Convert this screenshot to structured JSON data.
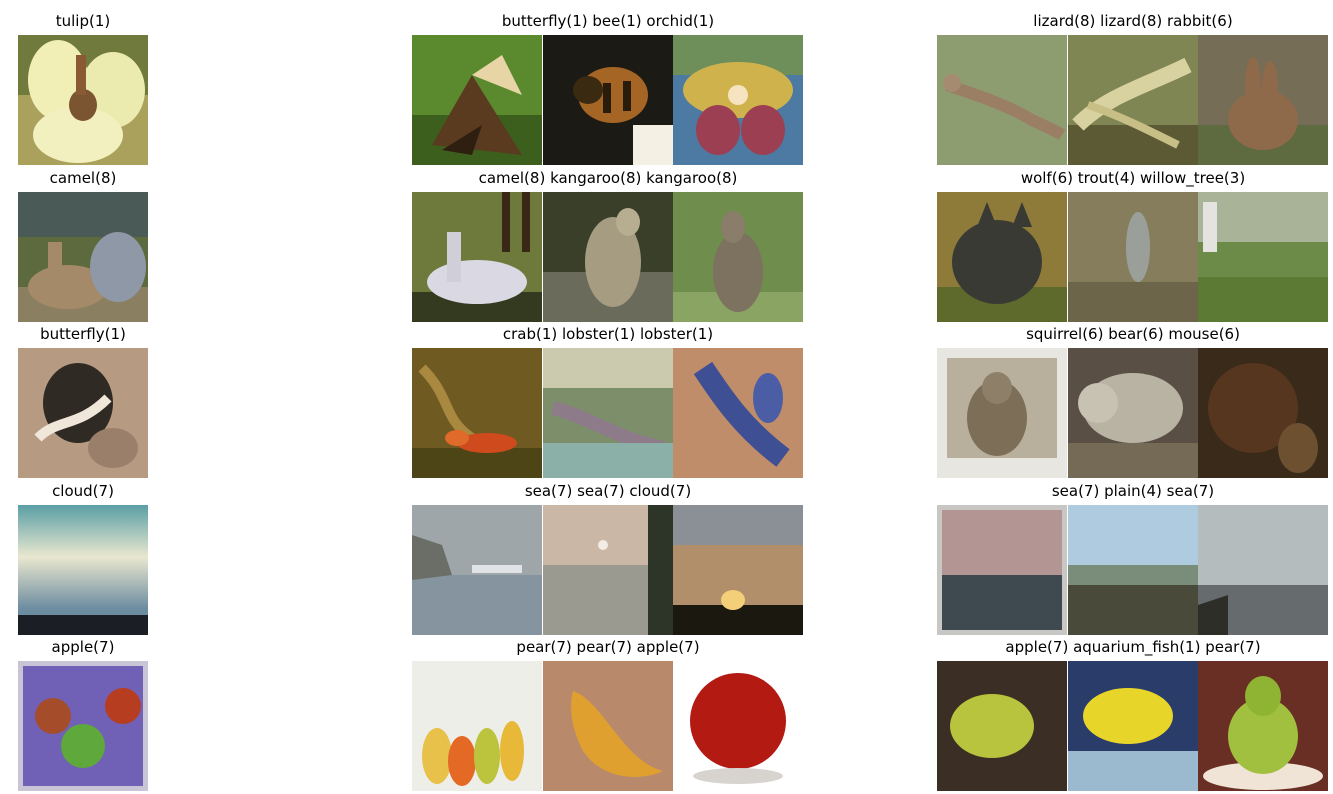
{
  "figure": {
    "rows": [
      {
        "left_title": "tulip(1)",
        "mid_title": "butterfly(1) bee(1) orchid(1)",
        "right_title": "lizard(8) lizard(8) rabbit(6)",
        "thumbs": {
          "left": [
            "tulip"
          ],
          "mid": [
            "butterfly",
            "bee",
            "orchid"
          ],
          "right": [
            "lizard",
            "lizard",
            "rabbit"
          ]
        }
      },
      {
        "left_title": "camel(8)",
        "mid_title": "camel(8) kangaroo(8) kangaroo(8)",
        "right_title": "wolf(6) trout(4) willow_tree(3)",
        "thumbs": {
          "left": [
            "camel"
          ],
          "mid": [
            "camel",
            "kangaroo",
            "kangaroo"
          ],
          "right": [
            "wolf",
            "trout",
            "willow_tree"
          ]
        }
      },
      {
        "left_title": "butterfly(1)",
        "mid_title": "crab(1) lobster(1) lobster(1)",
        "right_title": "squirrel(6) bear(6) mouse(6)",
        "thumbs": {
          "left": [
            "butterfly"
          ],
          "mid": [
            "crab",
            "lobster",
            "lobster"
          ],
          "right": [
            "squirrel",
            "bear",
            "mouse"
          ]
        }
      },
      {
        "left_title": "cloud(7)",
        "mid_title": "sea(7) sea(7) cloud(7)",
        "right_title": "sea(7) plain(4) sea(7)",
        "thumbs": {
          "left": [
            "cloud"
          ],
          "mid": [
            "sea",
            "sea",
            "cloud"
          ],
          "right": [
            "sea",
            "plain",
            "sea"
          ]
        }
      },
      {
        "left_title": "apple(7)",
        "mid_title": "pear(7) pear(7) apple(7)",
        "right_title": "apple(7) aquarium_fish(1) pear(7)",
        "thumbs": {
          "left": [
            "apple"
          ],
          "mid": [
            "pear",
            "pear",
            "apple"
          ],
          "right": [
            "apple",
            "aquarium_fish",
            "pear"
          ]
        }
      }
    ]
  }
}
